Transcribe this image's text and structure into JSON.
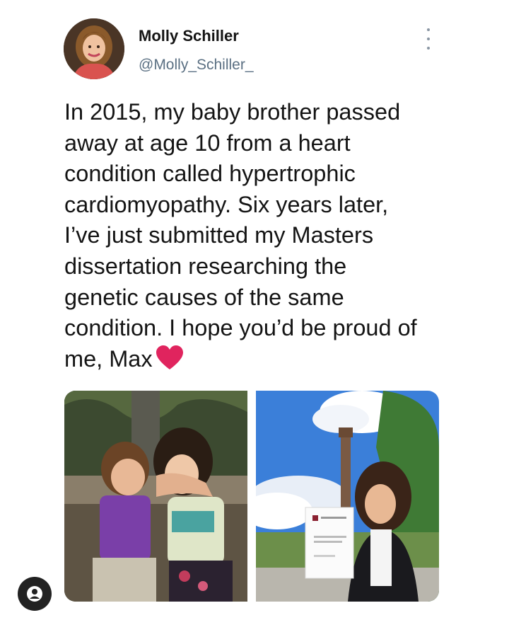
{
  "author": {
    "display_name": "Molly Schiller",
    "handle": "@Molly_Schiller_",
    "avatar_icon": "profile-photo"
  },
  "tweet": {
    "text": "In 2015, my baby brother passed\naway at age 10 from a heart\ncondition called hypertrophic\ncardiomyopathy. Six years later,\nI’ve just submitted my Masters\ndissertation researching the\ngenetic causes of the same\ncondition. I hope you’d be proud of\nme, Max",
    "emoji": "red-heart",
    "heart_color": "#e0245e"
  },
  "media": [
    {
      "name": "sibling-hug-photo"
    },
    {
      "name": "graduate-with-dissertation-photo"
    }
  ],
  "controls": {
    "more_icon": "more-vertical-icon",
    "profile_icon": "account-icon"
  }
}
